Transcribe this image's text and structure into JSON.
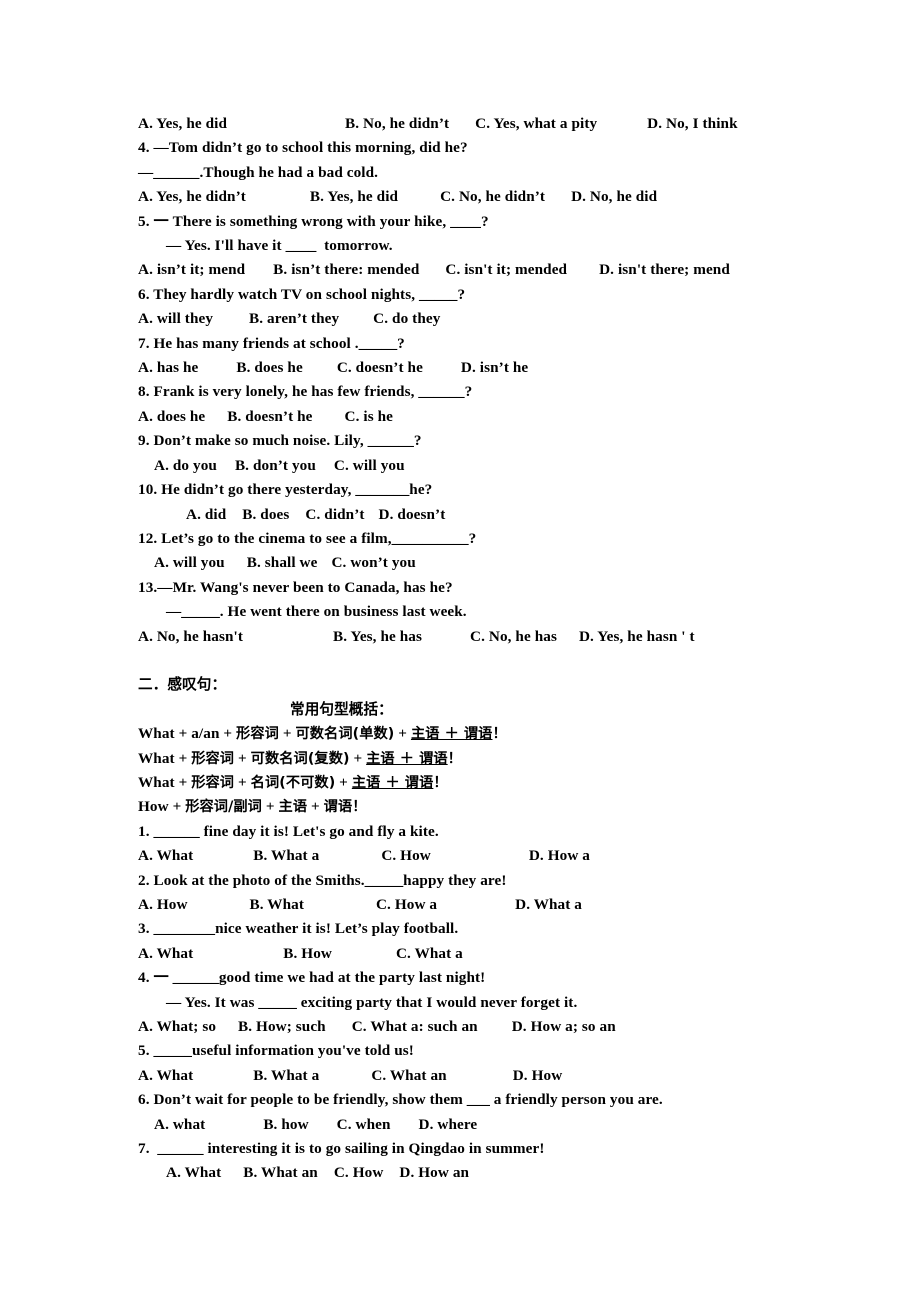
{
  "document": {
    "section_tag_questions": {
      "options_row_q3": [
        "A. Yes, he did",
        "B. No, he didn’t",
        "C. Yes, what a pity",
        "D. No, I think"
      ],
      "q4": {
        "stem_line1": "4. —Tom didn’t go to school this morning, did he?",
        "stem_line2_prefix": "—",
        "stem_line2_blank": "______",
        "stem_line2_suffix": ".Though he had a bad cold.",
        "options": [
          "A. Yes, he didn’t",
          "B. Yes, he did",
          "C. No, he didn’t",
          "D. No, he did"
        ]
      },
      "q5": {
        "stem_line1_prefix": "5. 一 There is something wrong with your hike, ",
        "stem_line1_blank": "____",
        "stem_line1_suffix": "?",
        "stem_line2_prefix": "— Yes. I'll have it ",
        "stem_line2_blank": "____",
        "stem_line2_suffix": "  tomorrow.",
        "options": [
          "A. isn’t it; mend",
          "B. isn’t there: mended",
          "C. isn't it; mended",
          "D. isn't there; mend"
        ]
      },
      "q6": {
        "stem_prefix": "6. They hardly watch TV on school nights, ",
        "stem_blank": "_____",
        "stem_suffix": "?",
        "options": [
          "A. will they",
          "B. aren’t they",
          "C. do they"
        ]
      },
      "q7": {
        "stem_prefix": "7. He has many friends at school .",
        "stem_blank": "_____",
        "stem_suffix": "?",
        "options": [
          "A. has he",
          "B. does he",
          "C. doesn’t he",
          "D. isn’t he"
        ]
      },
      "q8": {
        "stem_prefix": "8. Frank is very lonely, he has few friends, ",
        "stem_blank": "______",
        "stem_suffix": "?",
        "options": [
          "A. does he",
          "B. doesn’t he",
          "C. is he"
        ]
      },
      "q9": {
        "stem_prefix": "9. Don’t make so much noise. Lily, ",
        "stem_blank": "______",
        "stem_suffix": "?",
        "options": [
          "A. do you",
          "B. don’t you",
          "C. will you"
        ]
      },
      "q10": {
        "stem_prefix": "10. He didn’t go there yesterday, ",
        "stem_blank": "_______",
        "stem_suffix": "he?",
        "options": [
          "A. did",
          "B. does",
          "C. didn’t",
          "D. doesn’t"
        ]
      },
      "q12": {
        "stem_prefix": "12. Let’s go to the cinema to see a film,",
        "stem_blank": "__________",
        "stem_suffix": "?",
        "options": [
          "A. will you",
          "B. shall we",
          "C. won’t you"
        ]
      },
      "q13": {
        "stem_line1": "13.—Mr. Wang's never been to Canada, has he?",
        "stem_line2_prefix": "—",
        "stem_line2_blank": "_____",
        "stem_line2_suffix": ". He went there on business last week.",
        "options": [
          "A. No, he hasn't",
          "B. Yes, he has",
          "C. No, he has",
          "D. Yes, he hasn ' t"
        ]
      }
    },
    "section_exclamatory": {
      "heading": "二．感叹句：",
      "subheading": "常用句型概括：",
      "formulas": [
        {
          "plain": "What + a/an + ",
          "han1": "形容词",
          "mid": " + ",
          "han2": "可数名词(单数)",
          "plus": " + ",
          "underlined": "主语 ＋ 谓语",
          "end": "！"
        },
        {
          "plain": "What + ",
          "han1": "形容词",
          "mid": " + ",
          "han2": "可数名词(复数)",
          "plus": " + ",
          "underlined": "主语 ＋ 谓语",
          "end": "！"
        },
        {
          "plain": "What + ",
          "han1": "形容词",
          "mid": " + ",
          "han2": "名词(不可数)",
          "plus": " + ",
          "underlined": "主语 ＋ 谓语",
          "end": "！"
        },
        {
          "plain": "How + ",
          "han1": "形容词/副词",
          "mid": " + ",
          "han2": "主语",
          "plus": " + ",
          "underlined": "",
          "end": "谓语！"
        }
      ],
      "q1": {
        "stem_prefix": "1. ",
        "stem_blank": "______",
        "stem_suffix": " fine day it is! Let's go and fly a kite.",
        "options": [
          "A. What",
          "B. What a",
          "C. How",
          "D. How a"
        ]
      },
      "q2": {
        "stem_prefix": "2. Look at the photo of the Smiths.",
        "stem_blank": "_____",
        "stem_suffix": "happy they are!",
        "options": [
          "A. How",
          "B. What",
          "C. How a",
          "D. What a"
        ]
      },
      "q3": {
        "stem_prefix": "3. ",
        "stem_blank": "________",
        "stem_suffix": "nice weather it is! Let’s play football.",
        "options": [
          "A. What",
          "B. How",
          "C. What a"
        ]
      },
      "q4": {
        "stem_line1_prefix": "4. 一 ",
        "stem_line1_blank": "______",
        "stem_line1_suffix": "good time we had at the party last night!",
        "stem_line2_prefix": "— Yes. It was ",
        "stem_line2_blank": "_____",
        "stem_line2_suffix": " exciting party that I would never forget it.",
        "options": [
          "A. What; so",
          "B. How; such",
          "C. What a: such an",
          "D. How a; so an"
        ]
      },
      "q5": {
        "stem_prefix": "5. ",
        "stem_blank": "_____",
        "stem_suffix": "useful information you've told us!",
        "options": [
          "A. What",
          "B. What a",
          "C. What an",
          "D. How"
        ]
      },
      "q6": {
        "stem_prefix": "6. Don’t wait for people to be friendly, show them ",
        "stem_blank": "___",
        "stem_suffix": " a friendly person you are.",
        "options": [
          "A. what",
          "B. how",
          "C. when",
          "D. where"
        ]
      },
      "q7": {
        "stem_prefix": "7.  ",
        "stem_blank": "______",
        "stem_suffix": " interesting it is to go sailing in Qingdao in summer!",
        "options": [
          "A. What",
          "B. What an",
          "C. How",
          "D. How an"
        ]
      }
    }
  }
}
